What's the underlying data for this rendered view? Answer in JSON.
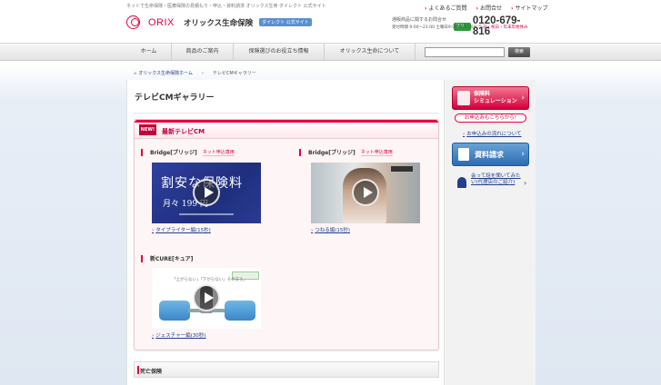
{
  "header": {
    "tagline": "ネットで生命保険・医療保険の見積もり・申込・資料請求 オリックス生命 ダイレクト 公式サイト",
    "logo_word": "ORIX",
    "company_name": "オリックス生命保険",
    "site_badge": "ダイレクト 公式サイト",
    "util_links": [
      "よくあるご質問",
      "お問合せ",
      "サイトマップ"
    ],
    "phone_label": "通販商品に関するお問合せ",
    "freedial_icon": "フリー",
    "phone_number": "0120-679-816",
    "phone_hours": "受付時間 9:00～21:00 土曜日9:00～18:00まで",
    "phone_closed": "日・祝日・年末年始休み"
  },
  "gnav": {
    "items": [
      "ホーム",
      "商品のご案内",
      "保険選びのお役立ち情報",
      "オリックス生命について"
    ],
    "search_button": "検索"
  },
  "breadcrumb": {
    "home": "オリックス生命保険ホーム",
    "current": "テレビCMギャラリー"
  },
  "main": {
    "page_title": "テレビCMギャラリー",
    "section_badge": "NEW!",
    "section_title": "最新テレビCM",
    "videos": [
      {
        "product": "Bridge[ブリッジ]",
        "tag": "ネット申込専用",
        "caption": "タイプライター編(15秒)",
        "thumb_big": "割安な保険料",
        "thumb_small": "月々 199 円"
      },
      {
        "product": "Bridge[ブリッジ]",
        "tag": "ネット申込専用",
        "caption": "つねる編(15秒)"
      },
      {
        "product": "新CURE[キュア]",
        "tag": "",
        "caption": "ジェスチャー編(30秒)",
        "thumb_text": "「上がらない」「下がらない」その支え。"
      }
    ],
    "section2_title": "死亡保険"
  },
  "side": {
    "sim_button": "保険料\nシミュレーション",
    "sim_sub": "お申込みもこちらから!",
    "flow_link": "お申込みの流れについて",
    "request_button": "資料請求",
    "consult_link": "会って話を聞いてみたい(代理店のご紹介)"
  }
}
